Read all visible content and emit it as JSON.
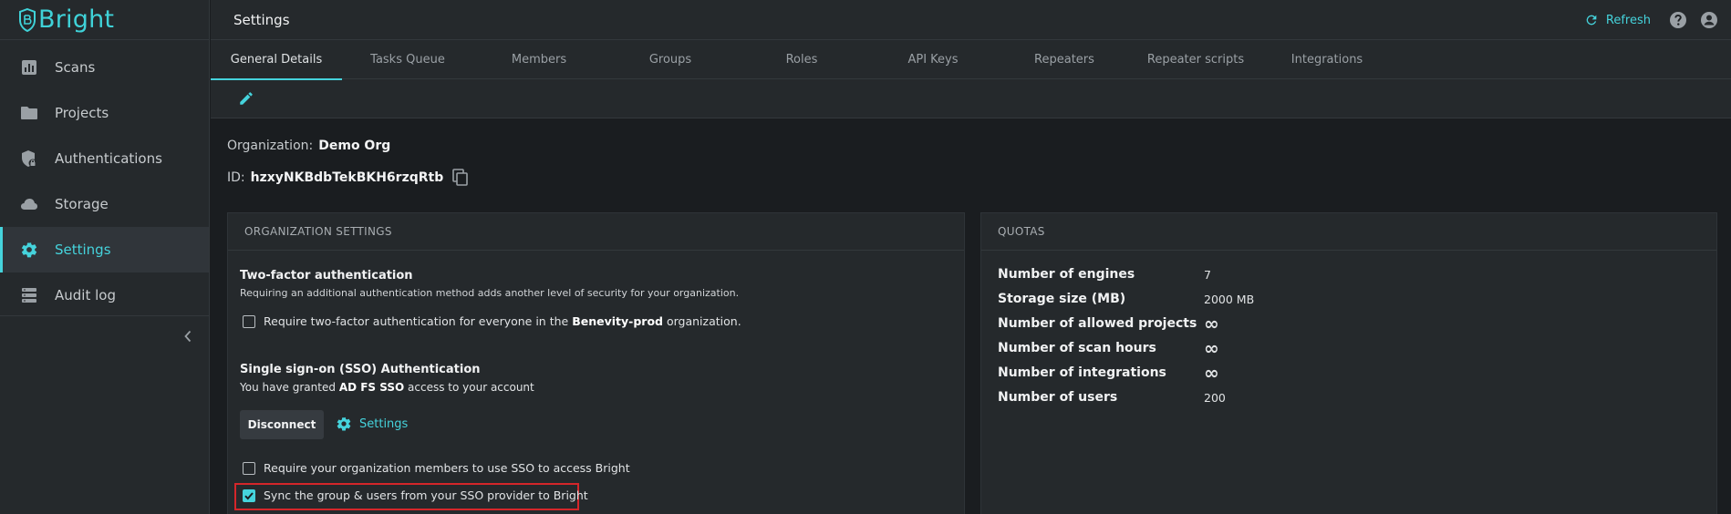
{
  "app": {
    "name": "Bright"
  },
  "sidebar": {
    "items": [
      {
        "label": "Scans",
        "icon": "chart-bar-icon"
      },
      {
        "label": "Projects",
        "icon": "folder-icon"
      },
      {
        "label": "Authentications",
        "icon": "shield-lock-icon"
      },
      {
        "label": "Storage",
        "icon": "cloud-icon"
      },
      {
        "label": "Settings",
        "icon": "gear-icon",
        "active": true
      },
      {
        "label": "Audit log",
        "icon": "list-icon"
      }
    ]
  },
  "header": {
    "title": "Settings",
    "refresh_label": "Refresh"
  },
  "tabs": [
    {
      "label": "General Details",
      "active": true
    },
    {
      "label": "Tasks Queue"
    },
    {
      "label": "Members"
    },
    {
      "label": "Groups"
    },
    {
      "label": "Roles"
    },
    {
      "label": "API Keys"
    },
    {
      "label": "Repeaters"
    },
    {
      "label": "Repeater scripts"
    },
    {
      "label": "Integrations"
    }
  ],
  "organization": {
    "name_label": "Organization:",
    "name": "Demo Org",
    "id_label": "ID:",
    "id": "hzxyNKBdbTekBKH6rzqRtb"
  },
  "org_settings": {
    "header": "ORGANIZATION SETTINGS",
    "two_factor": {
      "title": "Two-factor authentication",
      "description": "Requiring an additional authentication method adds another level of security for your organization.",
      "checkbox_prefix": "Require two-factor authentication for everyone in the",
      "org_name": "Benevity-prod",
      "checkbox_suffix": "organization.",
      "checked": false
    },
    "sso": {
      "title": "Single sign-on (SSO) Authentication",
      "granted_prefix": "You have granted",
      "provider": "AD FS SSO",
      "granted_suffix": "access to your account",
      "disconnect_label": "Disconnect",
      "settings_label": "Settings",
      "require_sso_label": "Require your organization members to use SSO to access Bright",
      "require_sso_checked": false,
      "sync_label": "Sync the group & users from your SSO provider to Bright",
      "sync_checked": true
    }
  },
  "quotas": {
    "header": "QUOTAS",
    "rows": [
      {
        "label": "Number of engines",
        "value": "7"
      },
      {
        "label": "Storage size (MB)",
        "value": "2000 MB"
      },
      {
        "label": "Number of allowed projects",
        "value": "∞"
      },
      {
        "label": "Number of scan hours",
        "value": "∞"
      },
      {
        "label": "Number of integrations",
        "value": "∞"
      },
      {
        "label": "Number of users",
        "value": "200"
      }
    ]
  },
  "colors": {
    "accent": "#45d3dc",
    "background": "#1a1d20",
    "panel": "#25292c",
    "highlight_border": "#d4262a"
  }
}
